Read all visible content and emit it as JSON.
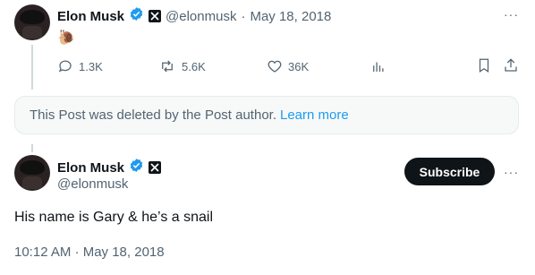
{
  "post1": {
    "author_name": "Elon Musk",
    "handle": "@elonmusk",
    "separator": "·",
    "date": "May 18, 2018",
    "content_emoji": "🐌",
    "more_label": "···",
    "stats": {
      "replies": "1.3K",
      "reposts": "5.6K",
      "likes": "36K"
    }
  },
  "deleted_notice": {
    "text": "This Post was deleted by the Post author.",
    "link": "Learn more"
  },
  "post2": {
    "author_name": "Elon Musk",
    "handle": "@elonmusk",
    "subscribe_label": "Subscribe",
    "more_label": "···",
    "text": "His name is Gary & he’s a snail",
    "timestamp": "10:12 AM · May 18, 2018"
  },
  "colors": {
    "verified_blue": "#1d9bf0",
    "link_blue": "#1d9bf0",
    "text_primary": "#0f1419",
    "text_secondary": "#536471"
  }
}
